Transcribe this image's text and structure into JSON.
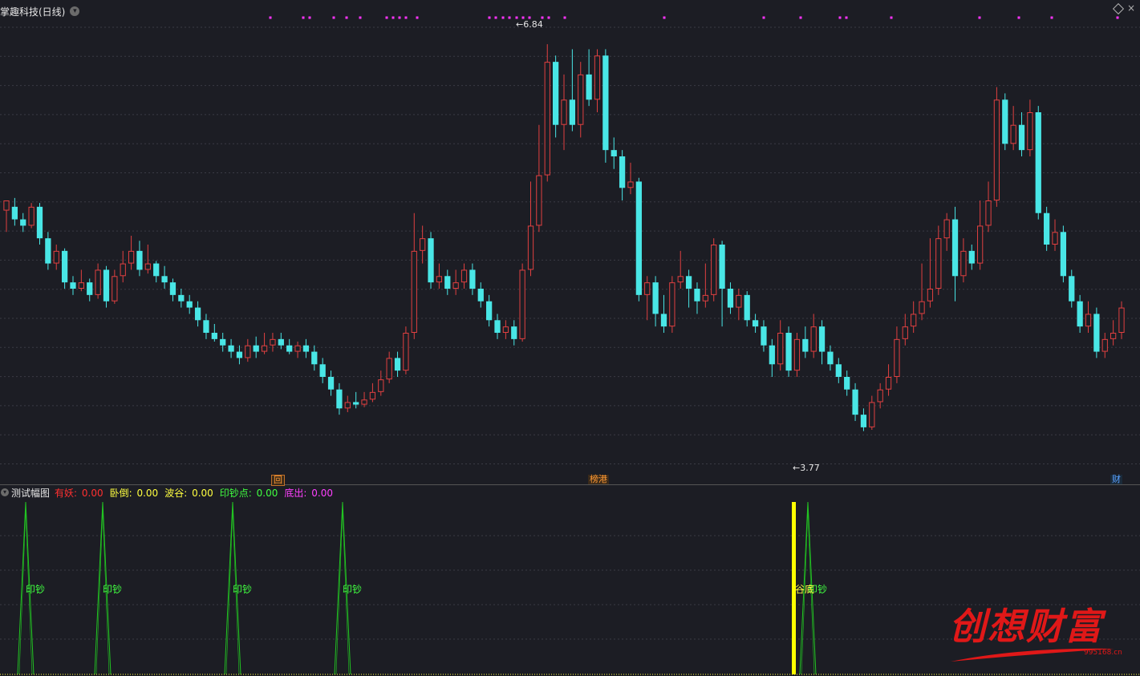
{
  "window": {
    "title": "掌趣科技(日线)",
    "menu_glyph": "▾",
    "close_glyph": "×"
  },
  "colors": {
    "background": "#1c1d24",
    "up": "#e04040",
    "down": "#49e6e6",
    "grid": "#3a3b44",
    "signal_dots": "#ff33ff",
    "spike": "#22c422",
    "valley_bar": "#ffff00",
    "watermark": "#e01818"
  },
  "markers": {
    "hui": "回",
    "bang": "榜港",
    "cai": "财"
  },
  "price_labels": {
    "high": "6.84",
    "low": "3.77",
    "arrow": "←"
  },
  "indicator": {
    "name": "测试幅图",
    "items": [
      {
        "label": "有妖:",
        "value": "0.00",
        "color": "#ff3030"
      },
      {
        "label": "卧倒:",
        "value": "0.00",
        "color": "#ffff40"
      },
      {
        "label": "波谷:",
        "value": "0.00",
        "color": "#ffff40"
      },
      {
        "label": "印钞点:",
        "value": "0.00",
        "color": "#40ff40"
      },
      {
        "label": "底出:",
        "value": "0.00",
        "color": "#ff40ff"
      }
    ],
    "spike_label": "印钞",
    "valley_label": "谷底"
  },
  "chart_data": {
    "type": "candlestick",
    "price_range": [
      3.5,
      7.0
    ],
    "high": 6.84,
    "low": 3.77,
    "candles": [
      [
        5.52,
        5.6,
        5.6,
        5.35
      ],
      [
        5.55,
        5.45,
        5.62,
        5.4
      ],
      [
        5.45,
        5.4,
        5.5,
        5.35
      ],
      [
        5.4,
        5.55,
        5.58,
        5.38
      ],
      [
        5.55,
        5.3,
        5.58,
        5.25
      ],
      [
        5.3,
        5.1,
        5.35,
        5.05
      ],
      [
        5.1,
        5.2,
        5.25,
        5.05
      ],
      [
        5.2,
        4.95,
        5.22,
        4.9
      ],
      [
        4.95,
        4.9,
        5.0,
        4.85
      ],
      [
        4.9,
        4.95,
        5.05,
        4.88
      ],
      [
        4.95,
        4.85,
        4.98,
        4.8
      ],
      [
        4.85,
        5.05,
        5.1,
        4.82
      ],
      [
        5.05,
        4.8,
        5.08,
        4.75
      ],
      [
        4.8,
        5.0,
        5.05,
        4.78
      ],
      [
        5.0,
        5.1,
        5.2,
        4.95
      ],
      [
        5.1,
        5.2,
        5.32,
        5.05
      ],
      [
        5.2,
        5.05,
        5.28,
        5.0
      ],
      [
        5.05,
        5.1,
        5.25,
        5.02
      ],
      [
        5.1,
        5.0,
        5.12,
        4.95
      ],
      [
        5.0,
        4.95,
        5.08,
        4.9
      ],
      [
        4.95,
        4.85,
        4.98,
        4.8
      ],
      [
        4.85,
        4.8,
        4.9,
        4.75
      ],
      [
        4.8,
        4.75,
        4.85,
        4.7
      ],
      [
        4.75,
        4.65,
        4.8,
        4.6
      ],
      [
        4.65,
        4.55,
        4.7,
        4.5
      ],
      [
        4.55,
        4.5,
        4.62,
        4.48
      ],
      [
        4.5,
        4.45,
        4.55,
        4.4
      ],
      [
        4.45,
        4.4,
        4.5,
        4.35
      ],
      [
        4.4,
        4.35,
        4.45,
        4.3
      ],
      [
        4.35,
        4.45,
        4.5,
        4.32
      ],
      [
        4.45,
        4.4,
        4.52,
        4.35
      ],
      [
        4.4,
        4.45,
        4.55,
        4.38
      ],
      [
        4.45,
        4.5,
        4.55,
        4.4
      ],
      [
        4.5,
        4.45,
        4.55,
        4.42
      ],
      [
        4.45,
        4.4,
        4.5,
        4.38
      ],
      [
        4.4,
        4.45,
        4.48,
        4.35
      ],
      [
        4.45,
        4.4,
        4.5,
        4.35
      ],
      [
        4.4,
        4.3,
        4.45,
        4.25
      ],
      [
        4.3,
        4.2,
        4.35,
        4.15
      ],
      [
        4.2,
        4.1,
        4.25,
        4.05
      ],
      [
        4.1,
        3.95,
        4.15,
        3.9
      ],
      [
        3.95,
        4.0,
        4.05,
        3.92
      ],
      [
        4.0,
        3.98,
        4.08,
        3.95
      ],
      [
        3.98,
        4.02,
        4.08,
        3.96
      ],
      [
        4.02,
        4.08,
        4.15,
        4.0
      ],
      [
        4.08,
        4.18,
        4.25,
        4.05
      ],
      [
        4.18,
        4.35,
        4.4,
        4.15
      ],
      [
        4.35,
        4.25,
        4.4,
        4.2
      ],
      [
        4.25,
        4.55,
        4.6,
        4.22
      ],
      [
        4.55,
        5.2,
        5.5,
        4.5
      ],
      [
        5.2,
        5.3,
        5.4,
        5.1
      ],
      [
        5.3,
        4.95,
        5.35,
        4.9
      ],
      [
        4.95,
        5.0,
        5.1,
        4.9
      ],
      [
        5.0,
        4.9,
        5.05,
        4.85
      ],
      [
        4.9,
        4.95,
        5.05,
        4.85
      ],
      [
        4.95,
        5.05,
        5.1,
        4.9
      ],
      [
        5.05,
        4.9,
        5.1,
        4.85
      ],
      [
        4.9,
        4.8,
        4.95,
        4.75
      ],
      [
        4.8,
        4.65,
        4.85,
        4.6
      ],
      [
        4.65,
        4.55,
        4.7,
        4.5
      ],
      [
        4.55,
        4.6,
        4.65,
        4.5
      ],
      [
        4.6,
        4.5,
        4.65,
        4.45
      ],
      [
        4.5,
        5.05,
        5.1,
        4.48
      ],
      [
        5.05,
        5.4,
        5.75,
        5.0
      ],
      [
        5.4,
        5.8,
        6.2,
        5.35
      ],
      [
        5.8,
        6.7,
        6.84,
        5.75
      ],
      [
        6.7,
        6.2,
        6.75,
        6.1
      ],
      [
        6.2,
        6.4,
        6.6,
        6.0
      ],
      [
        6.4,
        6.2,
        6.8,
        6.15
      ],
      [
        6.2,
        6.6,
        6.7,
        6.1
      ],
      [
        6.6,
        6.4,
        6.8,
        6.35
      ],
      [
        6.4,
        6.75,
        6.8,
        6.3
      ],
      [
        6.75,
        6.0,
        6.8,
        5.9
      ],
      [
        6.0,
        5.95,
        6.1,
        5.85
      ],
      [
        5.95,
        5.7,
        6.0,
        5.6
      ],
      [
        5.7,
        5.75,
        5.9,
        5.65
      ],
      [
        5.75,
        4.85,
        5.78,
        4.8
      ],
      [
        4.85,
        4.95,
        5.0,
        4.65
      ],
      [
        4.95,
        4.7,
        5.0,
        4.6
      ],
      [
        4.7,
        4.6,
        4.85,
        4.55
      ],
      [
        4.6,
        4.95,
        5.0,
        4.55
      ],
      [
        4.95,
        5.0,
        5.2,
        4.9
      ],
      [
        5.0,
        4.9,
        5.05,
        4.75
      ],
      [
        4.9,
        4.8,
        4.95,
        4.7
      ],
      [
        4.8,
        4.85,
        5.1,
        4.75
      ],
      [
        4.85,
        5.25,
        5.3,
        4.8
      ],
      [
        5.25,
        4.9,
        5.28,
        4.6
      ],
      [
        4.9,
        4.75,
        4.95,
        4.7
      ],
      [
        4.75,
        4.85,
        4.9,
        4.65
      ],
      [
        4.85,
        4.65,
        4.88,
        4.6
      ],
      [
        4.65,
        4.6,
        4.7,
        4.55
      ],
      [
        4.6,
        4.45,
        4.65,
        4.4
      ],
      [
        4.45,
        4.3,
        4.5,
        4.2
      ],
      [
        4.3,
        4.55,
        4.65,
        4.25
      ],
      [
        4.55,
        4.25,
        4.6,
        4.2
      ],
      [
        4.25,
        4.5,
        4.55,
        4.2
      ],
      [
        4.5,
        4.4,
        4.6,
        4.35
      ],
      [
        4.4,
        4.6,
        4.7,
        4.35
      ],
      [
        4.6,
        4.4,
        4.65,
        4.3
      ],
      [
        4.4,
        4.3,
        4.45,
        4.25
      ],
      [
        4.3,
        4.2,
        4.35,
        4.15
      ],
      [
        4.2,
        4.1,
        4.25,
        4.05
      ],
      [
        4.1,
        3.9,
        4.15,
        3.85
      ],
      [
        3.9,
        3.8,
        3.95,
        3.77
      ],
      [
        3.8,
        4.0,
        4.05,
        3.78
      ],
      [
        4.0,
        4.1,
        4.15,
        3.95
      ],
      [
        4.1,
        4.2,
        4.3,
        4.05
      ],
      [
        4.2,
        4.5,
        4.6,
        4.15
      ],
      [
        4.5,
        4.6,
        4.7,
        4.45
      ],
      [
        4.6,
        4.7,
        4.8,
        4.55
      ],
      [
        4.7,
        4.8,
        5.1,
        4.65
      ],
      [
        4.8,
        4.9,
        5.3,
        4.75
      ],
      [
        4.9,
        5.3,
        5.4,
        4.85
      ],
      [
        5.3,
        5.45,
        5.5,
        5.2
      ],
      [
        5.45,
        5.0,
        5.55,
        4.8
      ],
      [
        5.0,
        5.2,
        5.3,
        4.95
      ],
      [
        5.2,
        5.1,
        5.25,
        5.05
      ],
      [
        5.1,
        5.4,
        5.6,
        5.05
      ],
      [
        5.4,
        5.6,
        5.75,
        5.35
      ],
      [
        5.6,
        6.4,
        6.5,
        5.55
      ],
      [
        6.4,
        6.05,
        6.45,
        6.0
      ],
      [
        6.05,
        6.2,
        6.35,
        6.0
      ],
      [
        6.2,
        6.0,
        6.3,
        5.95
      ],
      [
        6.0,
        6.3,
        6.4,
        5.95
      ],
      [
        6.3,
        5.5,
        6.35,
        5.45
      ],
      [
        5.5,
        5.25,
        5.55,
        5.2
      ],
      [
        5.25,
        5.35,
        5.45,
        5.2
      ],
      [
        5.35,
        5.0,
        5.4,
        4.95
      ],
      [
        5.0,
        4.8,
        5.05,
        4.75
      ],
      [
        4.8,
        4.6,
        4.85,
        4.55
      ],
      [
        4.6,
        4.7,
        4.8,
        4.55
      ],
      [
        4.7,
        4.4,
        4.75,
        4.35
      ],
      [
        4.4,
        4.5,
        4.55,
        4.35
      ],
      [
        4.5,
        4.55,
        4.65,
        4.45
      ],
      [
        4.55,
        4.75,
        4.8,
        4.5
      ]
    ],
    "signal_dot_count": 31,
    "spike_count": 5
  }
}
